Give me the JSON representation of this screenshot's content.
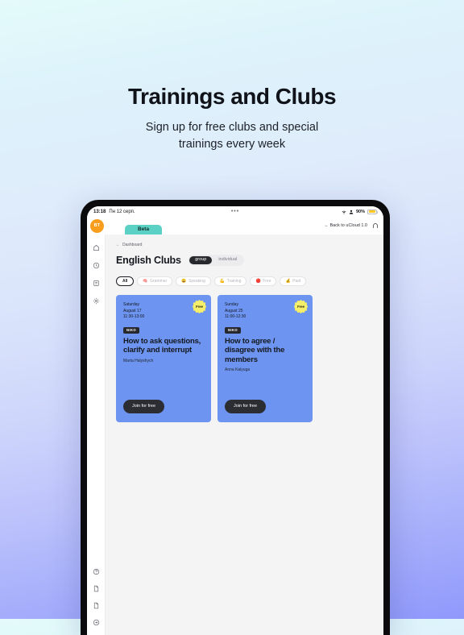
{
  "hero": {
    "title": "Trainings and Clubs",
    "subtitle_line1": "Sign up for free clubs and special",
    "subtitle_line2": "trainings every week"
  },
  "statusbar": {
    "time": "13:18",
    "date": "Пн 12 серп.",
    "dots": "•••",
    "battery_percent": "90%",
    "wifi_icon": "wifi-icon",
    "person_icon": "person-icon",
    "battery_icon": "battery-icon"
  },
  "appbar": {
    "avatar_initials": "BT",
    "tab_label": "Beta",
    "back_link": "← Back to uCloud 1.0",
    "arch_icon": "arch-icon"
  },
  "sidebar": {
    "top_items": [
      {
        "name": "sidebar-item-home",
        "icon": "home-icon"
      },
      {
        "name": "sidebar-item-clock",
        "icon": "clock-icon"
      },
      {
        "name": "sidebar-item-book",
        "icon": "book-icon"
      },
      {
        "name": "sidebar-item-settings",
        "icon": "gear-icon"
      }
    ],
    "bottom_items": [
      {
        "name": "sidebar-item-help",
        "icon": "help-circle-icon"
      },
      {
        "name": "sidebar-item-document-1",
        "icon": "document-icon"
      },
      {
        "name": "sidebar-item-document-2",
        "icon": "document-icon"
      },
      {
        "name": "sidebar-item-logout",
        "icon": "logout-icon"
      }
    ]
  },
  "content": {
    "breadcrumb": "Dashboard",
    "breadcrumb_arrow": "←",
    "page_title": "English Clubs",
    "segments": [
      {
        "label": "group",
        "active": true
      },
      {
        "label": "individual",
        "active": false
      }
    ],
    "filters": [
      {
        "label": "All",
        "emoji": "",
        "active": true
      },
      {
        "label": "Grammar",
        "emoji": "🧠",
        "active": false
      },
      {
        "label": "Speaking",
        "emoji": "😀",
        "active": false
      },
      {
        "label": "Training",
        "emoji": "💪",
        "active": false
      },
      {
        "label": "Free",
        "emoji": "🔴",
        "active": false
      },
      {
        "label": "Paid",
        "emoji": "💰",
        "active": false
      }
    ],
    "cards": [
      {
        "day": "Saturday",
        "date": "August 17",
        "time": "11:30-13:00",
        "badge": "NIKO",
        "title": "How to ask questions, clarify and interrupt",
        "author": "Marta Halyshych",
        "cta": "Join for free",
        "free_badge": "Free"
      },
      {
        "day": "Sunday",
        "date": "August 25",
        "time": "11:00-12:30",
        "badge": "NIKO",
        "title": "How to agree / disagree with the members",
        "author": "Anna Kalyuga",
        "cta": "Join for free",
        "free_badge": "Free"
      }
    ]
  },
  "colors": {
    "card_blue": "#6d94f0",
    "accent_teal": "#5ad1c4",
    "avatar_orange": "#f99d1c",
    "free_yellow": "#f5ef6a",
    "dark": "#26282d"
  }
}
